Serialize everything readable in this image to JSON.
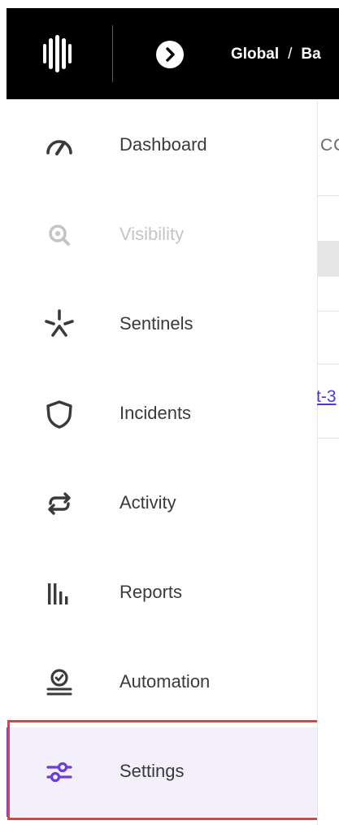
{
  "topbar": {
    "logo_icon": "sentinelone-logo-icon",
    "expand_icon": "chevron-right-circle-icon",
    "breadcrumb": {
      "global": "Global",
      "separator": "/",
      "next": "Ba"
    }
  },
  "sidebar": {
    "items": [
      {
        "label": "Dashboard",
        "icon": "speedometer-icon",
        "state": "normal"
      },
      {
        "label": "Visibility",
        "icon": "magnifier-icon",
        "state": "disabled"
      },
      {
        "label": "Sentinels",
        "icon": "sentinel-star-icon",
        "state": "normal"
      },
      {
        "label": "Incidents",
        "icon": "shield-icon",
        "state": "normal"
      },
      {
        "label": "Activity",
        "icon": "swap-arrows-icon",
        "state": "normal"
      },
      {
        "label": "Reports",
        "icon": "bar-chart-icon",
        "state": "normal"
      },
      {
        "label": "Automation",
        "icon": "automation-icon",
        "state": "normal"
      },
      {
        "label": "Settings",
        "icon": "sliders-icon",
        "state": "active"
      }
    ]
  },
  "content": {
    "header_fragment": "CC",
    "link_fragment": "t-3"
  },
  "colors": {
    "topbar_bg": "#000000",
    "accent": "#6b3fd6",
    "active_bg": "#f3effb",
    "highlight": "#ef3b3b",
    "text": "#3a3a3a",
    "disabled_text": "#c4c4c4"
  }
}
